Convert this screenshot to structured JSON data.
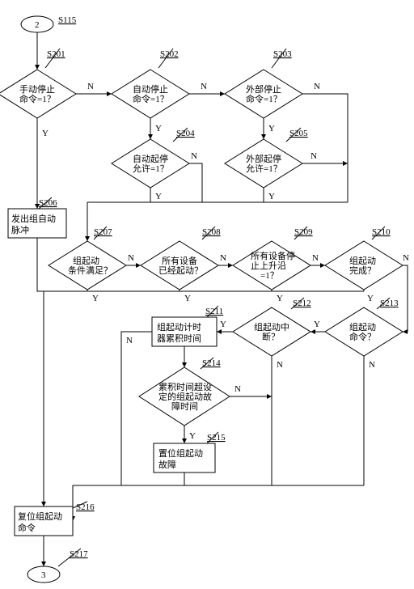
{
  "connector_in": {
    "label": "2",
    "tag": "S115"
  },
  "nodes": {
    "s201": {
      "tag": "S201",
      "text1": "手动停止",
      "text2": "命令=1？"
    },
    "s202": {
      "tag": "S202",
      "text1": "自动停止",
      "text2": "命令=1？"
    },
    "s203": {
      "tag": "S203",
      "text1": "外部停止",
      "text2": "命令=1？"
    },
    "s204": {
      "tag": "S204",
      "text1": "自动起停",
      "text2": "允许=1？"
    },
    "s205": {
      "tag": "S205",
      "text1": "外部起停",
      "text2": "允许=1？"
    },
    "s206": {
      "tag": "S206",
      "text1": "发出组自动",
      "text2": "脉冲"
    },
    "s207": {
      "tag": "S207",
      "text1": "组起动",
      "text2": "条件满足？"
    },
    "s208": {
      "tag": "S208",
      "text1": "所有设备",
      "text2": "已经起动？"
    },
    "s209": {
      "tag": "S209",
      "text1": "所有设备停",
      "text2": "止上升沿",
      "text3": "=1？"
    },
    "s210": {
      "tag": "S210",
      "text1": "组起动",
      "text2": "完成？"
    },
    "s211": {
      "tag": "S211",
      "text1": "组起动计时",
      "text2": "器累积时间"
    },
    "s212": {
      "tag": "S212",
      "text1": "组起动中",
      "text2": "断？"
    },
    "s213": {
      "tag": "S213",
      "text1": "组起动",
      "text2": "命令？"
    },
    "s214": {
      "tag": "S214",
      "text1": "累积时间超设",
      "text2": "定的组起动故",
      "text3": "障时间"
    },
    "s215": {
      "tag": "S215",
      "text1": "置位组起动",
      "text2": "故障"
    },
    "s216": {
      "tag": "S216",
      "text1": "复位组起动",
      "text2": "命令"
    },
    "s217": {
      "tag": "S217"
    }
  },
  "connector_out": {
    "label": "3"
  },
  "edge_labels": {
    "Y": "Y",
    "N": "N"
  }
}
